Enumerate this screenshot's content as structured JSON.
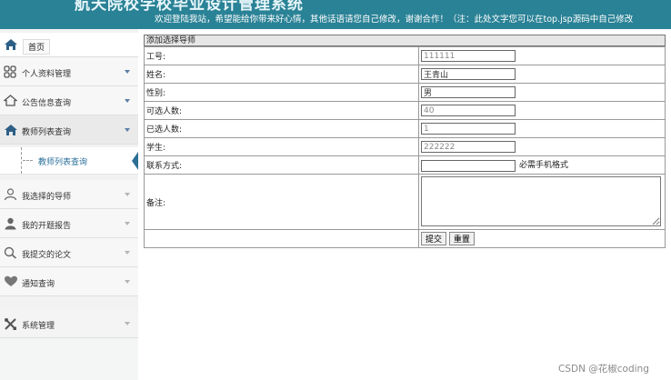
{
  "header": {
    "title": "航天院校学校毕业设计管理系统",
    "marquee": "欢迎登陆我站，希望能给你带来好心情，其他话语请您自己修改，谢谢合作！（注：此处文字您可以在top.jsp源码中自己修改"
  },
  "sidebar": {
    "home_label": "首页",
    "menus": [
      {
        "label": "个人资料管理"
      },
      {
        "label": "公告信息查询"
      },
      {
        "label": "教师列表查询"
      },
      {
        "label": "我选择的导师"
      },
      {
        "label": "我的开题报告"
      },
      {
        "label": "我提交的论文"
      },
      {
        "label": "通知查询"
      },
      {
        "label": "系统管理"
      }
    ],
    "submenu_label": "教师列表查询"
  },
  "form": {
    "title": "添加选择导师",
    "fields": [
      {
        "label": "工号:",
        "value": "111111"
      },
      {
        "label": "姓名:",
        "value": "王青山"
      },
      {
        "label": "性别:",
        "value": "男"
      },
      {
        "label": "可选人数:",
        "value": "40"
      },
      {
        "label": "已选人数:",
        "value": "1"
      },
      {
        "label": "学生:",
        "value": "222222"
      },
      {
        "label": "联系方式:",
        "value": "",
        "hint": "必需手机格式"
      },
      {
        "label": "备注:",
        "value": ""
      }
    ],
    "submit_label": "提交",
    "reset_label": "重置"
  },
  "watermark": "CSDN @花椒coding",
  "colors": {
    "header_bg": "#2a8296",
    "sidebar_bg": "#f2f2f2",
    "accent": "#2d6f94"
  }
}
